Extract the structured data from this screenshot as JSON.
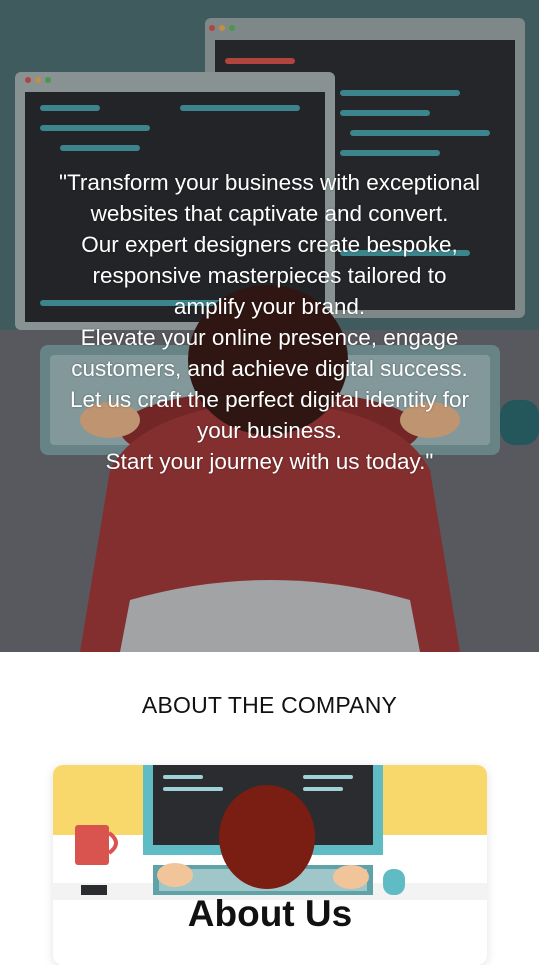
{
  "hero": {
    "lines": [
      "\"Transform your business with exceptional",
      "websites that captivate and convert.",
      "Our expert designers create bespoke,",
      "responsive masterpieces tailored to",
      "amplify your brand.",
      "Elevate your online presence, engage",
      "customers, and achieve digital success.",
      "Let us craft the perfect digital identity for",
      "your business.",
      "Start your journey with us today.\""
    ],
    "image_icon": "developer-at-computer-illustration",
    "colors": {
      "background": "#5b5d63",
      "shirt": "#b94a4a",
      "monitor": "#2b2b2b"
    }
  },
  "about": {
    "section_heading": "ABOUT THE COMPANY",
    "card_title": "About Us",
    "card_image_icon": "developer-at-desk-illustration",
    "colors": {
      "card_bg_top": "#f9d86b",
      "shirt": "#c0504d",
      "monitor_frame": "#5fbcc4"
    }
  }
}
